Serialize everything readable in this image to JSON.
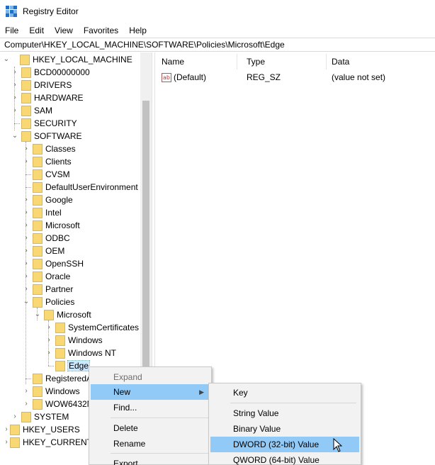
{
  "window": {
    "title": "Registry Editor"
  },
  "menu": [
    "File",
    "Edit",
    "View",
    "Favorites",
    "Help"
  ],
  "address": "Computer\\HKEY_LOCAL_MACHINE\\SOFTWARE\\Policies\\Microsoft\\Edge",
  "tree": {
    "hklm": "HKEY_LOCAL_MACHINE",
    "l1": [
      "BCD00000000",
      "DRIVERS",
      "HARDWARE",
      "SAM",
      "SECURITY",
      "SOFTWARE"
    ],
    "software_children": [
      "Classes",
      "Clients",
      "CVSM",
      "DefaultUserEnvironment",
      "Google",
      "Intel",
      "Microsoft",
      "ODBC",
      "OEM",
      "OpenSSH",
      "Oracle",
      "Partner",
      "Policies"
    ],
    "policies_child": "Microsoft",
    "microsoft_children": [
      "SystemCertificates",
      "Windows",
      "Windows NT",
      "Edge"
    ],
    "software_tail": [
      "RegisteredA",
      "Windows",
      "WOW6432N"
    ],
    "system": "SYSTEM",
    "roots_tail": [
      "HKEY_USERS",
      "HKEY_CURRENT_"
    ]
  },
  "columns": [
    "Name",
    "Type",
    "Data"
  ],
  "values": [
    {
      "name": "(Default)",
      "type": "REG_SZ",
      "data": "(value not set)",
      "icon": "ab-string-icon"
    }
  ],
  "context_menu": {
    "items": [
      "Expand",
      "New",
      "Find...",
      "Delete",
      "Rename",
      "Export"
    ],
    "disabled": [
      "Expand"
    ],
    "highlighted": "New"
  },
  "submenu": {
    "items": [
      "Key",
      "String Value",
      "Binary Value",
      "DWORD (32-bit) Value",
      "QWORD (64-bit) Value"
    ],
    "highlighted": "DWORD (32-bit) Value"
  },
  "colors": {
    "highlight": "#91c9f7",
    "selection": "#cce8ff",
    "folder": "#f8d775"
  }
}
